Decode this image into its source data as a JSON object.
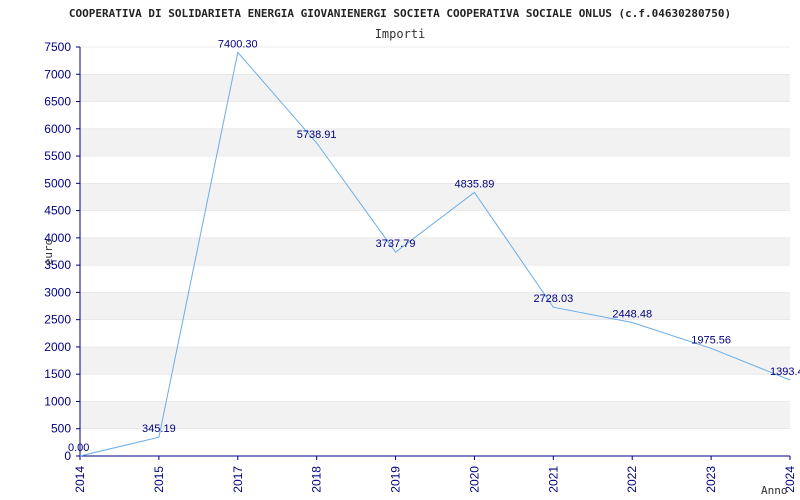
{
  "chart_data": {
    "type": "line",
    "title": "COOPERATIVA DI SOLIDARIETA ENERGIA GIOVANIENERGI SOCIETA COOPERATIVA SOCIALE ONLUS (c.f.04630280750)",
    "subtitle": "Importi",
    "xlabel": "Anno",
    "ylabel": "euro",
    "x": [
      "2014",
      "2015",
      "2017",
      "2018",
      "2019",
      "2020",
      "2021",
      "2022",
      "2023",
      "2024"
    ],
    "series": [
      {
        "values": [
          0,
          345.19,
          7400.3,
          5738.91,
          3737.79,
          4835.89,
          2728.03,
          2448.48,
          1975.56,
          1393.4
        ],
        "labels": [
          "0.00",
          "345.19",
          "7400.30",
          "5738.91",
          "3737.79",
          "4835.89",
          "2728.03",
          "2448.48",
          "1975.56",
          "1393.4"
        ]
      }
    ],
    "ylim": [
      0,
      7500
    ],
    "yticks": [
      "0",
      "500",
      "1000",
      "1500",
      "2000",
      "2500",
      "3000",
      "3500",
      "4000",
      "4500",
      "5000",
      "5500",
      "6000",
      "6500",
      "7000",
      "7500"
    ],
    "grid": true,
    "colors": {
      "line": "#6aaee8",
      "band": "#f2f2f2",
      "axis": "#000080",
      "gridline": "#dddddd"
    }
  }
}
